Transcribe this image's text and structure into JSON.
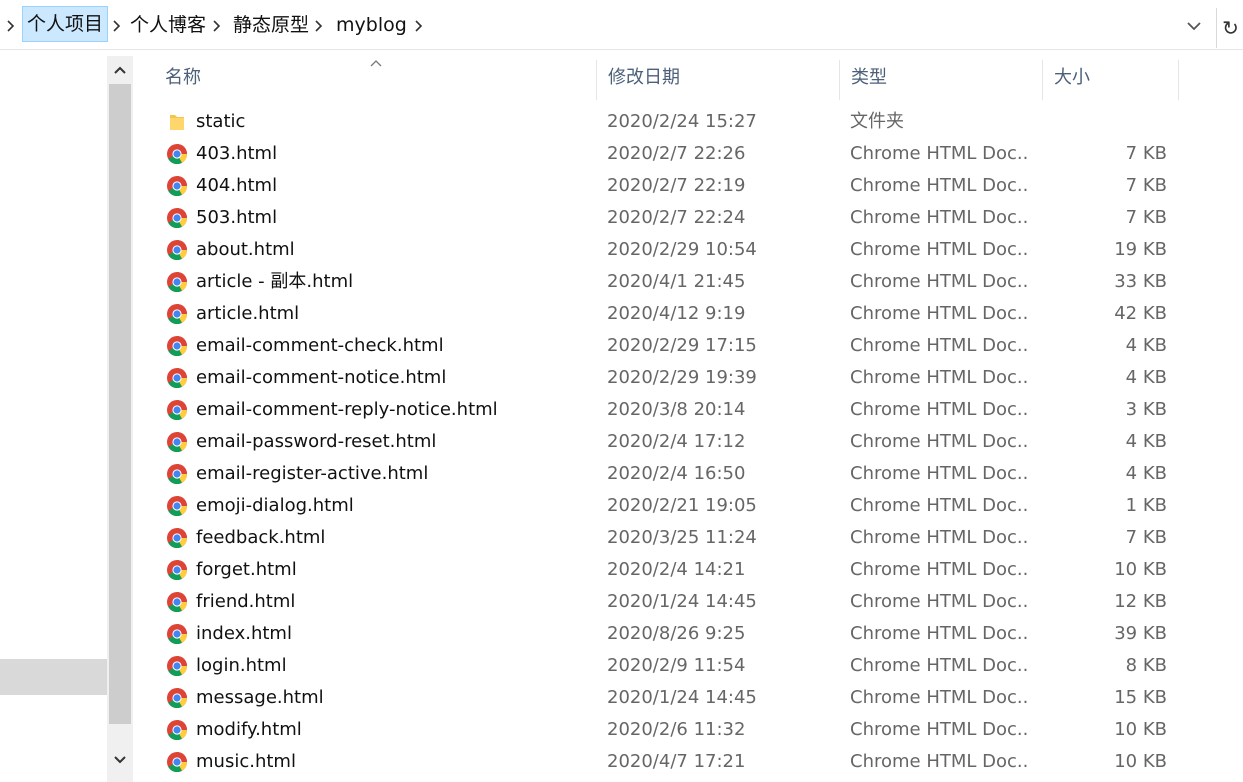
{
  "breadcrumb": {
    "items": [
      "个人项目",
      "个人博客",
      "静态原型",
      "myblog"
    ]
  },
  "columns": {
    "name": "名称",
    "date": "修改日期",
    "type": "类型",
    "size": "大小"
  },
  "files": [
    {
      "name": "static",
      "date": "2020/2/24 15:27",
      "type": "文件夹",
      "size": "",
      "icon": "folder-icon"
    },
    {
      "name": "403.html",
      "date": "2020/2/7 22:26",
      "type": "Chrome HTML Doc...",
      "size": "7 KB",
      "icon": "chrome-icon"
    },
    {
      "name": "404.html",
      "date": "2020/2/7 22:19",
      "type": "Chrome HTML Doc...",
      "size": "7 KB",
      "icon": "chrome-icon"
    },
    {
      "name": "503.html",
      "date": "2020/2/7 22:24",
      "type": "Chrome HTML Doc...",
      "size": "7 KB",
      "icon": "chrome-icon"
    },
    {
      "name": "about.html",
      "date": "2020/2/29 10:54",
      "type": "Chrome HTML Doc...",
      "size": "19 KB",
      "icon": "chrome-icon"
    },
    {
      "name": "article - 副本.html",
      "date": "2020/4/1 21:45",
      "type": "Chrome HTML Doc...",
      "size": "33 KB",
      "icon": "chrome-icon"
    },
    {
      "name": "article.html",
      "date": "2020/4/12 9:19",
      "type": "Chrome HTML Doc...",
      "size": "42 KB",
      "icon": "chrome-icon"
    },
    {
      "name": "email-comment-check.html",
      "date": "2020/2/29 17:15",
      "type": "Chrome HTML Doc...",
      "size": "4 KB",
      "icon": "chrome-icon"
    },
    {
      "name": "email-comment-notice.html",
      "date": "2020/2/29 19:39",
      "type": "Chrome HTML Doc...",
      "size": "4 KB",
      "icon": "chrome-icon"
    },
    {
      "name": "email-comment-reply-notice.html",
      "date": "2020/3/8 20:14",
      "type": "Chrome HTML Doc...",
      "size": "3 KB",
      "icon": "chrome-icon"
    },
    {
      "name": "email-password-reset.html",
      "date": "2020/2/4 17:12",
      "type": "Chrome HTML Doc...",
      "size": "4 KB",
      "icon": "chrome-icon"
    },
    {
      "name": "email-register-active.html",
      "date": "2020/2/4 16:50",
      "type": "Chrome HTML Doc...",
      "size": "4 KB",
      "icon": "chrome-icon"
    },
    {
      "name": "emoji-dialog.html",
      "date": "2020/2/21 19:05",
      "type": "Chrome HTML Doc...",
      "size": "1 KB",
      "icon": "chrome-icon"
    },
    {
      "name": "feedback.html",
      "date": "2020/3/25 11:24",
      "type": "Chrome HTML Doc...",
      "size": "7 KB",
      "icon": "chrome-icon"
    },
    {
      "name": "forget.html",
      "date": "2020/2/4 14:21",
      "type": "Chrome HTML Doc...",
      "size": "10 KB",
      "icon": "chrome-icon"
    },
    {
      "name": "friend.html",
      "date": "2020/1/24 14:45",
      "type": "Chrome HTML Doc...",
      "size": "12 KB",
      "icon": "chrome-icon"
    },
    {
      "name": "index.html",
      "date": "2020/8/26 9:25",
      "type": "Chrome HTML Doc...",
      "size": "39 KB",
      "icon": "chrome-icon"
    },
    {
      "name": "login.html",
      "date": "2020/2/9 11:54",
      "type": "Chrome HTML Doc...",
      "size": "8 KB",
      "icon": "chrome-icon"
    },
    {
      "name": "message.html",
      "date": "2020/1/24 14:45",
      "type": "Chrome HTML Doc...",
      "size": "15 KB",
      "icon": "chrome-icon"
    },
    {
      "name": "modify.html",
      "date": "2020/2/6 11:32",
      "type": "Chrome HTML Doc...",
      "size": "10 KB",
      "icon": "chrome-icon"
    },
    {
      "name": "music.html",
      "date": "2020/4/7 17:21",
      "type": "Chrome HTML Doc...",
      "size": "10 KB",
      "icon": "chrome-icon"
    }
  ],
  "colors": {
    "header_text": "#4c607a",
    "active_crumb_bg": "#cce8ff",
    "secondary_text": "#666666"
  }
}
